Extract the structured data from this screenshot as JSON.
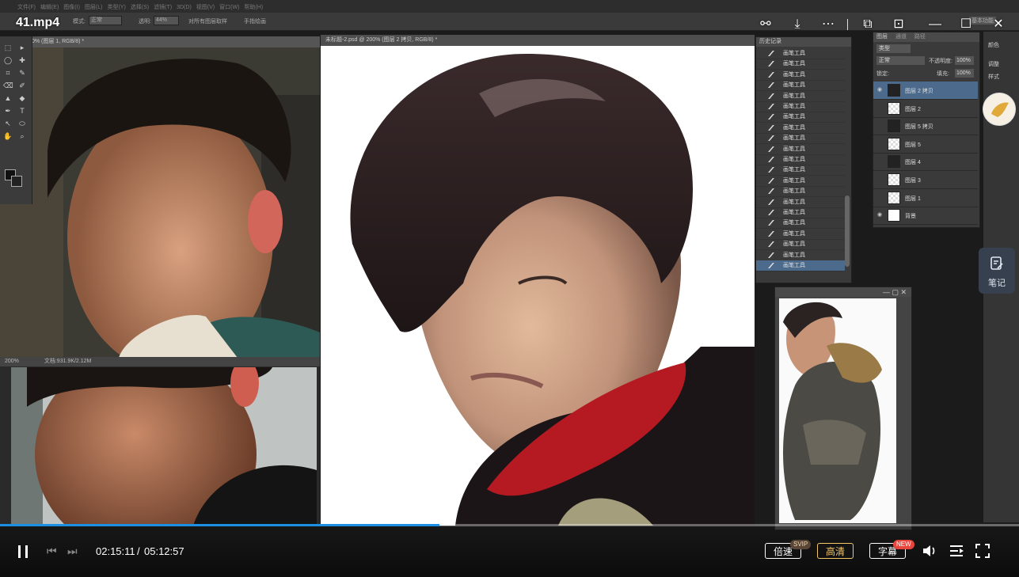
{
  "player": {
    "title": "41.mp4",
    "current_time": "02:15:11",
    "time_separator": "/",
    "duration": "05:12:57",
    "progress_fraction": 0.431,
    "speed_label": "倍速",
    "speed_badge": "SVIP",
    "quality_label": "高清",
    "subtitle_label": "字幕",
    "subtitle_badge": "NEW",
    "notes_label": "笔记",
    "accent_color": "#1a8fe3",
    "quality_color": "#f5c76a"
  },
  "photoshop": {
    "menu": [
      "文件(F)",
      "编辑(E)",
      "图像(I)",
      "图层(L)",
      "类型(Y)",
      "选择(S)",
      "滤镜(T)",
      "3D(D)",
      "视图(V)",
      "窗口(W)",
      "帮助(H)"
    ],
    "options": {
      "mode_label": "模式:",
      "mode_value": "正常",
      "opacity_label": "透明:",
      "opacity_value": "44%",
      "sample_label": "对所有图层取样",
      "auto_label": "手指绘画"
    },
    "workspace": "基本功能",
    "doc1_tab": "1.jpg @ 200% (图层 1, RGB/8) *",
    "doc1_zoom": "200%",
    "doc1_size": "文档:931.9K/2.12M",
    "doc2_tab": "未标题-2.psd @ 200% (图层 2 拷贝, RGB/8) *",
    "history_title": "历史记录",
    "history_items": [
      "画笔工具",
      "画笔工具",
      "画笔工具",
      "画笔工具",
      "画笔工具",
      "画笔工具",
      "画笔工具",
      "画笔工具",
      "画笔工具",
      "画笔工具",
      "画笔工具",
      "画笔工具",
      "画笔工具",
      "画笔工具",
      "画笔工具",
      "画笔工具",
      "画笔工具",
      "画笔工具",
      "画笔工具",
      "画笔工具",
      "画笔工具"
    ],
    "layers_tabs": [
      "图层",
      "通道",
      "路径"
    ],
    "layers_kind": "类型",
    "layers_blend": "正常",
    "layers_opacity_label": "不透明度:",
    "layers_opacity": "100%",
    "layers_lock_label": "锁定:",
    "layers_fill_label": "填充:",
    "layers_fill": "100%",
    "layers": [
      {
        "name": "图层 2 拷贝",
        "thumb": "dark"
      },
      {
        "name": "图层 2",
        "thumb": "check"
      },
      {
        "name": "图层 5 拷贝",
        "thumb": "dark"
      },
      {
        "name": "图层 5",
        "thumb": "check"
      },
      {
        "name": "图层 4",
        "thumb": "dark"
      },
      {
        "name": "图层 3",
        "thumb": "check"
      },
      {
        "name": "图层 1",
        "thumb": "check"
      },
      {
        "name": "背景",
        "thumb": "white"
      }
    ],
    "side_panel": [
      "颜色",
      "调整",
      "样式"
    ]
  }
}
